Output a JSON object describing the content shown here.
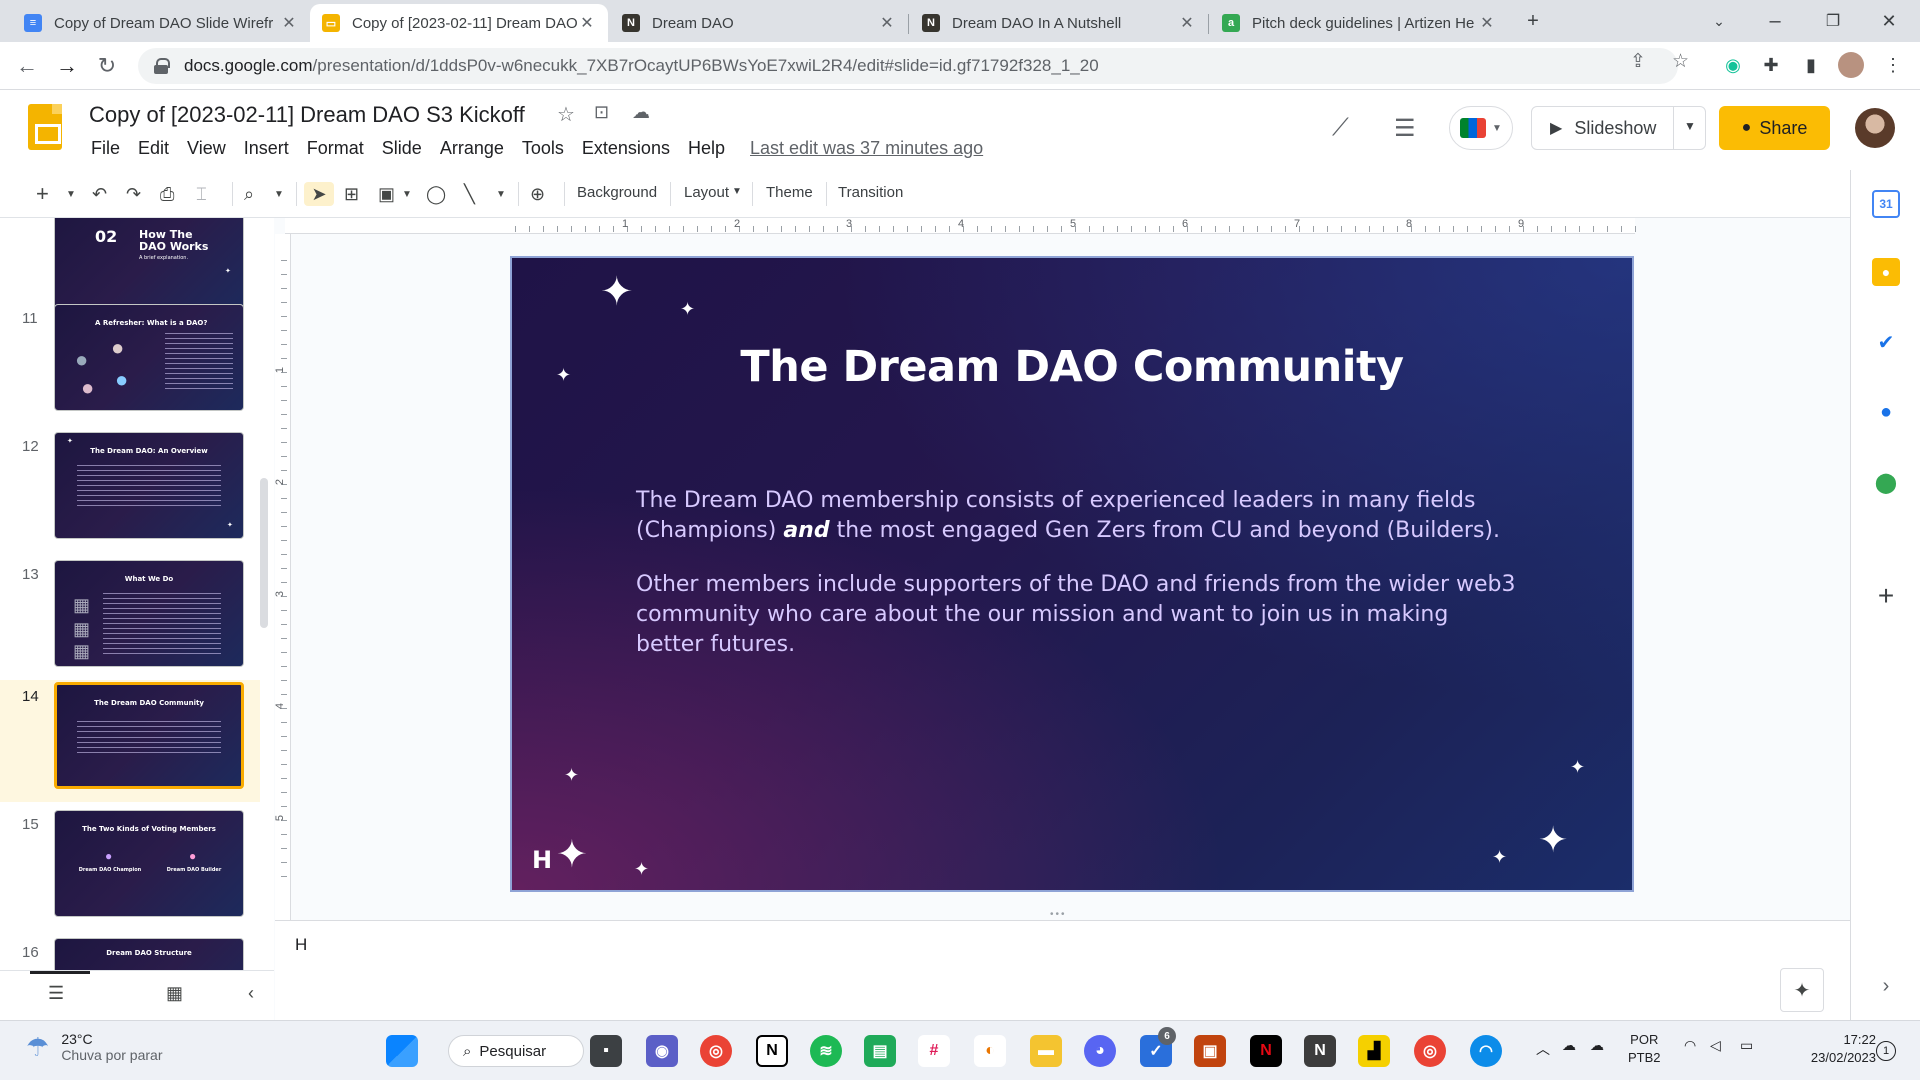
{
  "browser": {
    "tabs": [
      {
        "title": "Copy of Dream DAO Slide Wirefr",
        "icon": "docs-icon",
        "active": false
      },
      {
        "title": "Copy of [2023-02-11] Dream DAO",
        "icon": "slides-icon",
        "active": true
      },
      {
        "title": "Dream DAO",
        "icon": "notion-icon",
        "active": false
      },
      {
        "title": "Dream DAO In A Nutshell",
        "icon": "notion-icon",
        "active": false
      },
      {
        "title": "Pitch deck guidelines | Artizen He",
        "icon": "artizen-icon",
        "active": false
      }
    ],
    "url_domain": "docs.google.com",
    "url_path": "/presentation/d/1ddsP0v-w6necukk_7XB7rOcaytUP6BWsYoE7xwiL2R4/edit#slide=id.gf71792f328_1_20"
  },
  "app": {
    "doc_title": "Copy of [2023-02-11] Dream DAO S3 Kickoff",
    "menu": [
      "File",
      "Edit",
      "View",
      "Insert",
      "Format",
      "Slide",
      "Arrange",
      "Tools",
      "Extensions",
      "Help"
    ],
    "last_edit": "Last edit was 37 minutes ago",
    "slideshow_label": "Slideshow",
    "share_label": "Share",
    "brand_color": "#fbbc04"
  },
  "toolbar": {
    "background": "Background",
    "layout": "Layout",
    "theme": "Theme",
    "transition": "Transition"
  },
  "ruler": {
    "h_marks": [
      "1",
      "2",
      "3",
      "4",
      "5",
      "6",
      "7",
      "8",
      "9"
    ],
    "v_marks": [
      "1",
      "2",
      "3",
      "4",
      "5"
    ]
  },
  "filmstrip": {
    "slides": [
      {
        "num": "",
        "title": "How The DAO Works",
        "badge": "02",
        "subtitle": "A brief explanation."
      },
      {
        "num": "11",
        "title": "A Refresher: What is a DAO?"
      },
      {
        "num": "12",
        "title": "The Dream DAO: An Overview"
      },
      {
        "num": "13",
        "title": "What We Do"
      },
      {
        "num": "14",
        "title": "The Dream DAO Community",
        "selected": true
      },
      {
        "num": "15",
        "title": "The Two Kinds of Voting Members",
        "sub1": "Dream DAO Champion",
        "sub2": "Dream DAO Builder"
      },
      {
        "num": "16",
        "title": "Dream DAO Structure"
      }
    ]
  },
  "slide": {
    "title": "The Dream DAO Community",
    "para1_a": "The Dream DAO membership consists of experienced leaders in many fields (Champions) ",
    "para1_em": "and",
    "para1_b": " the most engaged Gen Zers from CU and beyond (Builders).",
    "para2": "Other members include supporters of the DAO and friends from the wider web3 community who care about the our mission and want to join us in making better futures.",
    "logo_letter": "H"
  },
  "notes": {
    "text": "H"
  },
  "taskbar": {
    "temperature": "23°C",
    "weather": "Chuva por parar",
    "search_label": "Pesquisar",
    "lang_top": "POR",
    "lang_bottom": "PTB2",
    "time": "17:22",
    "date": "23/02/2023",
    "notification_count": "1",
    "steam_badge": "6"
  }
}
